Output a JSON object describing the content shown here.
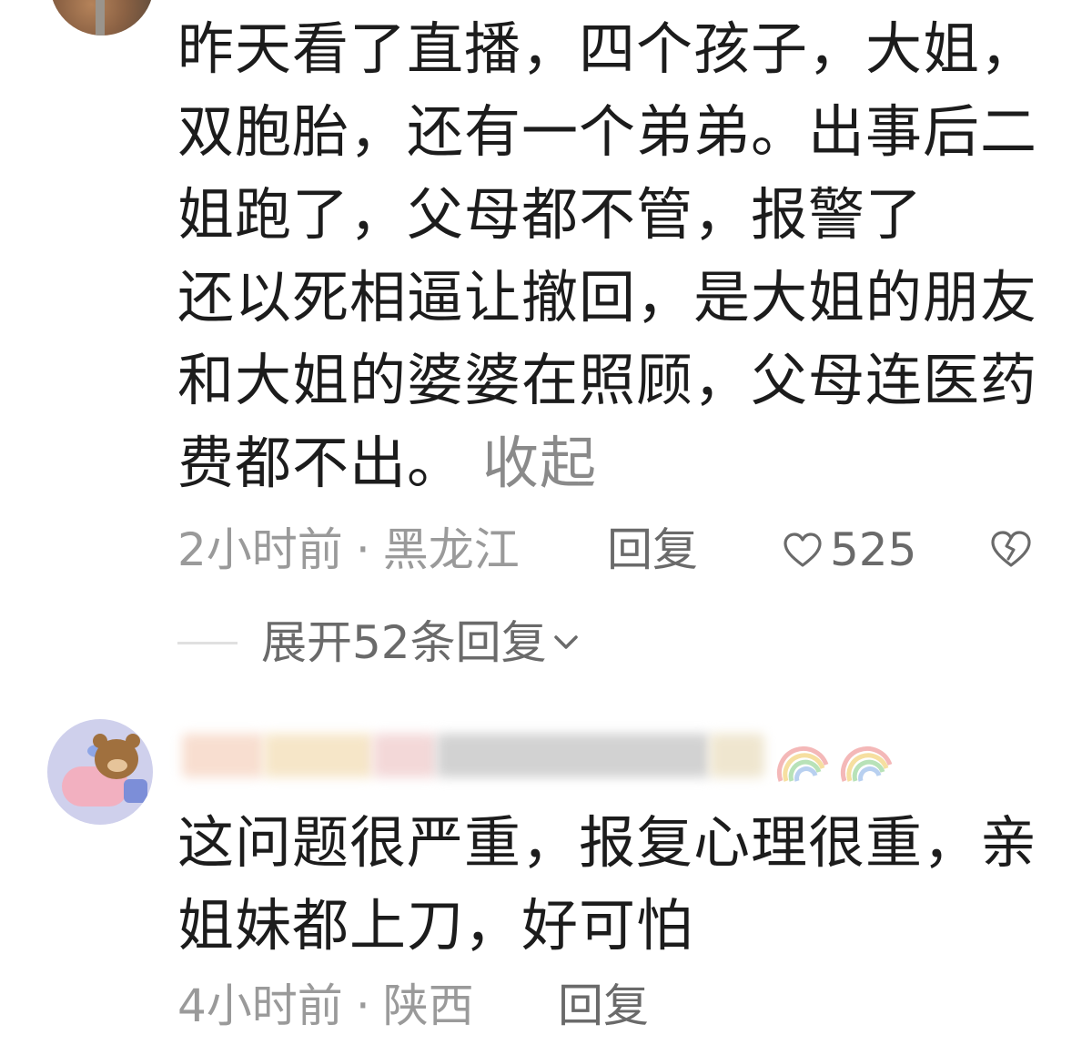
{
  "comments": [
    {
      "text": "昨天看了直播，四个孩子，大姐，双胞胎，还有一个弟弟。出事后二姐跑了，父母都不管，报警了\n还以死相逼让撤回，是大姐的朋友和大姐的婆婆在照顾，父母连医药费都不出。",
      "collapse_label": "收起",
      "time": "2小时前",
      "separator": "·",
      "location": "黑龙江",
      "reply_label": "回复",
      "like_count": "525",
      "expand_replies_label": "展开52条回复"
    },
    {
      "text": "这问题很严重，报复心理很重，亲姐妹都上刀，好可怕",
      "time": "4小时前",
      "separator": "·",
      "location": "陕西",
      "reply_label": "回复"
    }
  ],
  "icons": {
    "like": "heart-outline-icon",
    "dislike": "broken-heart-icon",
    "expand": "chevron-down-icon"
  },
  "colors": {
    "text_primary": "#1c1c1c",
    "text_secondary": "#9a9a9a",
    "text_action": "#6a6a6a",
    "avatar_bg": "#cfd0ec"
  }
}
